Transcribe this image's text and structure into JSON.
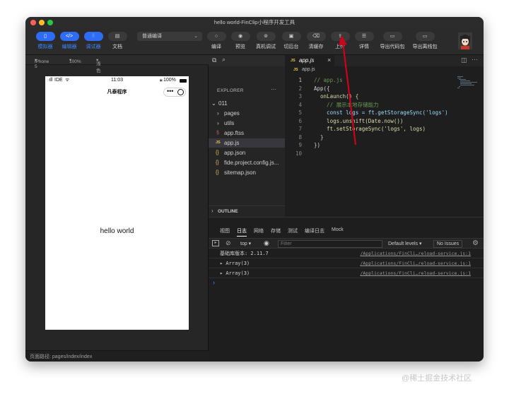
{
  "window": {
    "title": "hello world-FinClip小程序开发工具"
  },
  "colors": {
    "accent": "#2f6cf5",
    "arrow": "#d0021b"
  },
  "toolbar": {
    "left_buttons": [
      {
        "icon": "phone-icon",
        "label": "模拟器"
      },
      {
        "icon": "code-icon",
        "label": "编辑器"
      },
      {
        "icon": "debug-icon",
        "label": "调试器"
      },
      {
        "icon": "doc-icon",
        "label": "文档"
      }
    ],
    "compile_mode": "普通编译",
    "right_buttons": [
      {
        "icon": "compile-icon",
        "label": "编译"
      },
      {
        "icon": "eye-icon",
        "label": "预览"
      },
      {
        "icon": "device-icon",
        "label": "真机调试"
      },
      {
        "icon": "background-icon",
        "label": "切后台"
      },
      {
        "icon": "clear-icon",
        "label": "清缓存"
      },
      {
        "icon": "upload-icon",
        "label": "上传"
      },
      {
        "icon": "details-icon",
        "label": "详情"
      },
      {
        "icon": "export-icon",
        "label": "导出代码包"
      },
      {
        "icon": "export-offline-icon",
        "label": "导出离线包"
      }
    ]
  },
  "simulator": {
    "device": "iPhone 5",
    "zoom": "100%",
    "theme": "浅色",
    "status_left": "IDE",
    "status_time": "11:03",
    "status_battery": "100%",
    "nav_title": "凡泰程序",
    "content": "hello world",
    "footer": "页面路径: pages/index/index"
  },
  "explorer": {
    "title": "EXPLORER",
    "root": "011",
    "items": [
      {
        "name": "pages",
        "kind": "folder"
      },
      {
        "name": "utils",
        "kind": "folder"
      },
      {
        "name": "app.ftss",
        "kind": "style"
      },
      {
        "name": "app.js",
        "kind": "js"
      },
      {
        "name": "app.json",
        "kind": "json"
      },
      {
        "name": "fide.project.config.js...",
        "kind": "json"
      },
      {
        "name": "sitemap.json",
        "kind": "json"
      }
    ],
    "outline": "OUTLINE"
  },
  "editor": {
    "tab": "app.js",
    "tab_badge": "JS",
    "breadcrumb": "app.js",
    "lines": [
      "// app.js",
      "App({",
      "  onLaunch() {",
      "    // 展示本地存储能力",
      "    const logs = ft.getStorageSync('logs')",
      "    logs.unshift(Date.now())",
      "    ft.setStorageSync('logs', logs)",
      "  }",
      "})",
      ""
    ]
  },
  "console": {
    "tabs": [
      "视图",
      "日志",
      "网络",
      "存储",
      "测试",
      "编译日志",
      "Mock"
    ],
    "active_tab": "日志",
    "context": "top",
    "filter_placeholder": "Filter",
    "levels": "Default levels",
    "issues": "No Issues",
    "rows": [
      {
        "msg": "基础库版本: 2.11.7",
        "src": "/Applications/FinCli…reload-service.js:1"
      },
      {
        "msg": "▸ Array(3)",
        "src": "/Applications/FinCli…reload-service.js:1"
      },
      {
        "msg": "▸ Array(3)",
        "src": "/Applications/FinCli…reload-service.js:1"
      }
    ],
    "prompt": "›"
  },
  "watermark": "@稀土掘金技术社区"
}
